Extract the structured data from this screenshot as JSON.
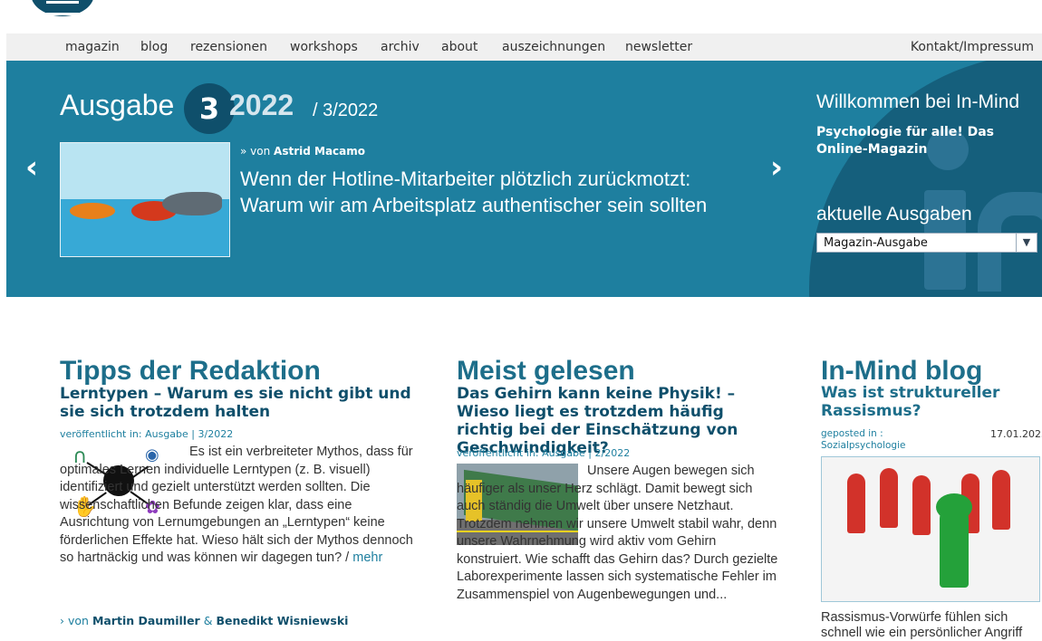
{
  "nav": {
    "items": [
      "magazin",
      "blog",
      "rezensionen",
      "workshops",
      "archiv",
      "about",
      "auszeichnungen",
      "newsletter"
    ],
    "right": "Kontakt/Impressum"
  },
  "hero": {
    "issue_label": "Ausgabe",
    "issue_number": "3",
    "issue_year": "2022",
    "issue_sub": "/ 3/2022",
    "prev": "‹",
    "next": "›",
    "featured": {
      "author_prefix": "» von",
      "author": "Astrid Macamo",
      "title": "Wenn der Hotline-Mitarbeiter plötzlich zurückmotzt: Warum wir am Arbeitsplatz authentischer sein sollten"
    },
    "welcome": {
      "title": "Willkommen bei In-Mind",
      "subtitle": "Psychologie für alle! Das Online-Magazin"
    },
    "issues": {
      "title": "aktuelle Ausgaben",
      "selected": "Magazin-Ausgabe"
    }
  },
  "columns": {
    "tipps": {
      "title": "Tipps der Redaktion",
      "article": {
        "title": "Lerntypen – Warum es sie nicht gibt und sie sich trotzdem halten",
        "meta": "veröffentlicht in: Ausgabe | 3/2022",
        "text": "Es ist ein verbreiteter Mythos, dass für optimales Lernen individuelle Lerntypen (z. B. visuell) identifiziert und gezielt unterstützt werden sollten. Die wissenschaftlichen Befunde zeigen klar, dass eine Ausrichtung von Lernumgebungen an „Lerntypen“ keine förderlichen Effekte hat. Wieso hält sich der Mythos dennoch so hartnäckig und was können wir dagegen tun? /",
        "more": "mehr",
        "author_prefix": "› von",
        "author1": "Martin Daumiller",
        "amp": "&",
        "author2": "Benedikt Wisniewski"
      }
    },
    "meist": {
      "title": "Meist gelesen",
      "article": {
        "title": "Das Gehirn kann keine Physik! – Wieso liegt es trotzdem häufig richtig bei der Einschätzung von Geschwindigkeit?",
        "meta": "veröffentlicht in: Ausgabe | 2/2022",
        "text": "Unsere Augen bewegen sich häufiger als unser Herz schlägt. Damit bewegt sich auch ständig die Umwelt über unsere Netzhaut. Trotzdem nehmen wir unsere Umwelt stabil wahr, denn unsere Wahrnehmung wird aktiv vom Gehirn konstruiert. Wie schafft das Gehirn das? Durch gezielte Laborexperimente lassen sich systematische Fehler im Zusammenspiel von Augenbewegungen und..."
      }
    },
    "blog": {
      "title": "In-Mind blog",
      "article": {
        "title": "Was ist struktureller Rassismus?",
        "posted_label": "geposted in :",
        "category": "Sozialpsychologie",
        "date": "17.01.2023",
        "text": "Rassismus-Vorwürfe fühlen sich schnell wie ein persönlicher Angriff"
      }
    }
  }
}
